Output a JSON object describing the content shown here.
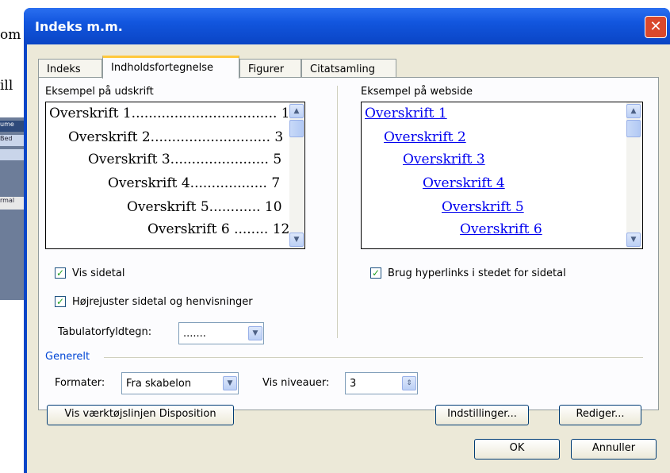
{
  "background": {
    "text1": "om",
    "text2": "ill",
    "strip_labels": [
      "ume",
      "Bed",
      "rmal"
    ]
  },
  "dialog": {
    "title": "Indeks m.m.",
    "close_label": "✕"
  },
  "tabs": [
    {
      "label": "Indeks"
    },
    {
      "label": "Indholdsfortegnelse",
      "active": true
    },
    {
      "label": "Figurer"
    },
    {
      "label": "Citatsamling"
    }
  ],
  "print_preview": {
    "label": "Eksempel på udskrift",
    "lines": [
      {
        "text": "Overskrift 1.................................. 1"
      },
      {
        "text": "Overskrift 2............................ 3"
      },
      {
        "text": "Overskrift 3....................... 5"
      },
      {
        "text": "Overskrift 4.................. 7"
      },
      {
        "text": "Overskrift 5............ 10"
      },
      {
        "text": "Overskrift 6 ........ 12"
      }
    ]
  },
  "web_preview": {
    "label": "Eksempel på webside",
    "lines": [
      "Overskrift 1",
      "Overskrift 2",
      "Overskrift 3",
      "Overskrift 4",
      "Overskrift 5",
      "Overskrift 6"
    ]
  },
  "options": {
    "show_page_numbers": {
      "label": "Vis sidetal",
      "checked": true
    },
    "right_align": {
      "label": "Højrejuster sidetal og henvisninger",
      "checked": true
    },
    "use_hyperlinks": {
      "label": "Brug hyperlinks i stedet for sidetal",
      "checked": true
    },
    "tab_leader": {
      "label": "Tabulatorfyldtegn:",
      "value": "......."
    }
  },
  "general": {
    "label": "Generelt",
    "formats": {
      "label": "Formater:",
      "value": "Fra skabelon"
    },
    "levels": {
      "label": "Vis niveauer:",
      "value": "3"
    }
  },
  "buttons": {
    "outline_toolbar": "Vis værktøjslinjen Disposition",
    "settings": "Indstillinger...",
    "modify": "Rediger...",
    "ok": "OK",
    "cancel": "Annuller"
  },
  "colors": {
    "titlebar": "#0a45c8",
    "dialog_bg": "#ece9d8",
    "link": "#0000ee",
    "group_label": "#0046d5"
  }
}
